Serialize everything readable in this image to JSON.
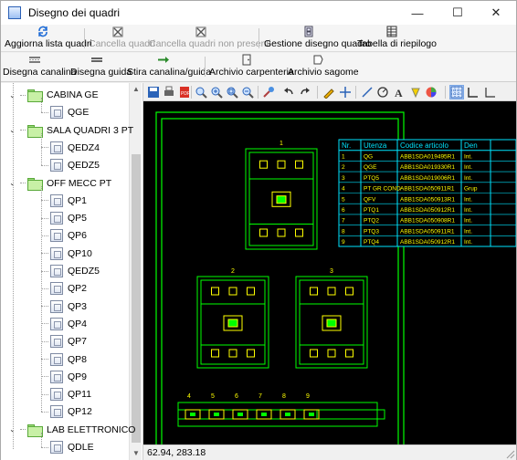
{
  "window": {
    "title": "Disegno dei quadri",
    "controls": {
      "minimize": "—",
      "maximize": "☐",
      "close": "✕"
    }
  },
  "toolbar1": [
    {
      "label": "Aggiorna lista quadri",
      "icon": "refresh-icon",
      "enabled": true
    },
    {
      "label": "Cancella quadri",
      "icon": "delete-panel-icon",
      "enabled": false
    },
    {
      "label": "Cancella quadri non presenti",
      "icon": "delete-missing-icon",
      "enabled": false
    },
    {
      "label": "Gestione disegno quadro",
      "icon": "panel-drawing-icon",
      "enabled": true
    },
    {
      "label": "Tabella di riepilogo",
      "icon": "table-icon",
      "enabled": true
    }
  ],
  "toolbar2": [
    {
      "label": "Disegna canalina",
      "icon": "duct-icon"
    },
    {
      "label": "Disegna guida",
      "icon": "rail-icon"
    },
    {
      "label": "Stira canalina/guida",
      "icon": "stretch-icon"
    },
    {
      "label": "Archivio carpenteria",
      "icon": "enclosure-archive-icon"
    },
    {
      "label": "Archivio sagome",
      "icon": "shapes-archive-icon"
    }
  ],
  "tree": {
    "groups": [
      {
        "label": "CABINA GE",
        "children": [
          "QGE"
        ]
      },
      {
        "label": "SALA QUADRI 3 PT",
        "children": [
          "QEDZ4",
          "QEDZ5"
        ]
      },
      {
        "label": "OFF MECC PT",
        "children": [
          "QP1",
          "QP5",
          "QP6",
          "QP10",
          "QEDZ5",
          "QP2",
          "QP3",
          "QP4",
          "QP7",
          "QP8",
          "QP9",
          "QP11",
          "QP12"
        ]
      },
      {
        "label": "LAB ELETTRONICO",
        "children": [
          "QDLE"
        ]
      }
    ]
  },
  "drawing_tools": [
    "save-icon",
    "print-icon",
    "pdf-icon",
    "zoom-extents-icon",
    "zoom-in-icon",
    "zoom-window-icon",
    "zoom-out-icon",
    "paint-icon",
    "undo-icon",
    "redo-icon",
    "pencil-icon",
    "move-icon",
    "line-icon",
    "circle-icon",
    "text-icon",
    "fill-icon",
    "color-icon",
    "grid-icon",
    "snap-icon",
    "ortho-icon"
  ],
  "canvas": {
    "colors": {
      "frame": "#00ff00",
      "table": "#00e5ff",
      "table_text": "#ffff00",
      "labels": "#ffff00"
    },
    "modules": [
      "1",
      "2",
      "3"
    ],
    "rail_labels": [
      "4",
      "5",
      "6",
      "7",
      "8",
      "9"
    ],
    "table": {
      "headers": [
        "Nr.",
        "Utenza",
        "Codice articolo",
        "Den"
      ],
      "rows": [
        [
          "1",
          "QG",
          "ABB1SDA019495R1",
          "Int."
        ],
        [
          "2",
          "QGE",
          "ABB1SDA019330R1",
          "Int."
        ],
        [
          "3",
          "PTQ5",
          "ABB1SDA019006R1",
          "Int."
        ],
        [
          "4",
          "PT GR COND",
          "ABB1SDA050911R1",
          "Grup"
        ],
        [
          "5",
          "QFV",
          "ABB1SDA050913R1",
          "Int."
        ],
        [
          "6",
          "PTQ1",
          "ABB1SDA050912R1",
          "Int."
        ],
        [
          "7",
          "PTQ2",
          "ABB1SDA050908R1",
          "Int."
        ],
        [
          "8",
          "PTQ3",
          "ABB1SDA050911R1",
          "Int."
        ],
        [
          "9",
          "PTQ4",
          "ABB1SDA050912R1",
          "Int."
        ]
      ]
    }
  },
  "status": {
    "coordinates": "62.94, 283.18"
  }
}
